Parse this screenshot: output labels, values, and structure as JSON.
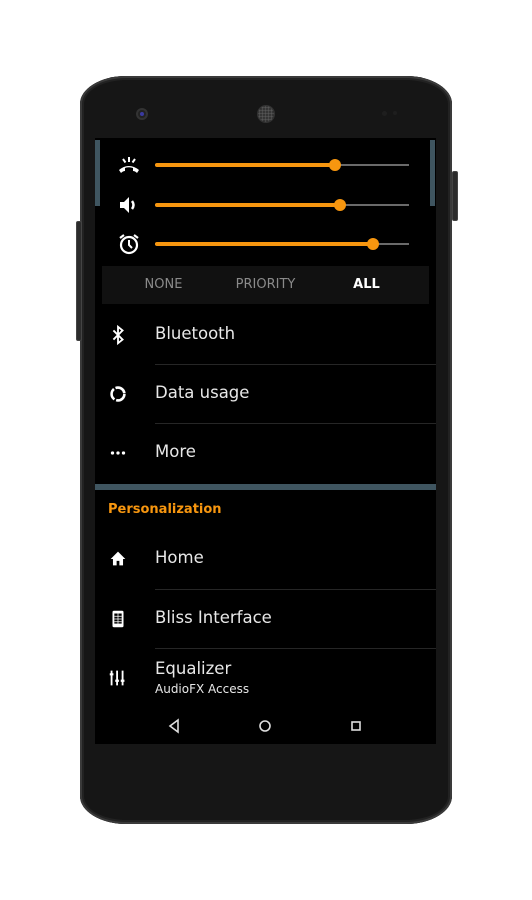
{
  "theme": {
    "accent": "#f7960f",
    "background": "#000000",
    "divider": "#3f5560"
  },
  "volume_panel": {
    "sliders": [
      {
        "name": "ringer",
        "icon": "ringer-icon",
        "value_percent": 71
      },
      {
        "name": "media",
        "icon": "speaker-icon",
        "value_percent": 73
      },
      {
        "name": "alarm",
        "icon": "alarm-clock-icon",
        "value_percent": 86
      }
    ],
    "interruption_modes": [
      "NONE",
      "PRIORITY",
      "ALL"
    ],
    "selected_mode": "ALL"
  },
  "settings": {
    "wireless_items": [
      {
        "label": "Bluetooth",
        "icon": "bluetooth-icon"
      },
      {
        "label": "Data usage",
        "icon": "data-usage-icon"
      },
      {
        "label": "More",
        "icon": "more-dots-icon"
      }
    ],
    "personalization": {
      "title": "Personalization",
      "items": [
        {
          "label": "Home",
          "icon": "home-icon"
        },
        {
          "label": "Bliss Interface",
          "icon": "phone-interface-icon"
        },
        {
          "label": "Equalizer",
          "subtitle": "AudioFX Access",
          "icon": "equalizer-icon"
        }
      ]
    }
  },
  "navbar": {
    "buttons": [
      "back",
      "home",
      "recents"
    ]
  }
}
